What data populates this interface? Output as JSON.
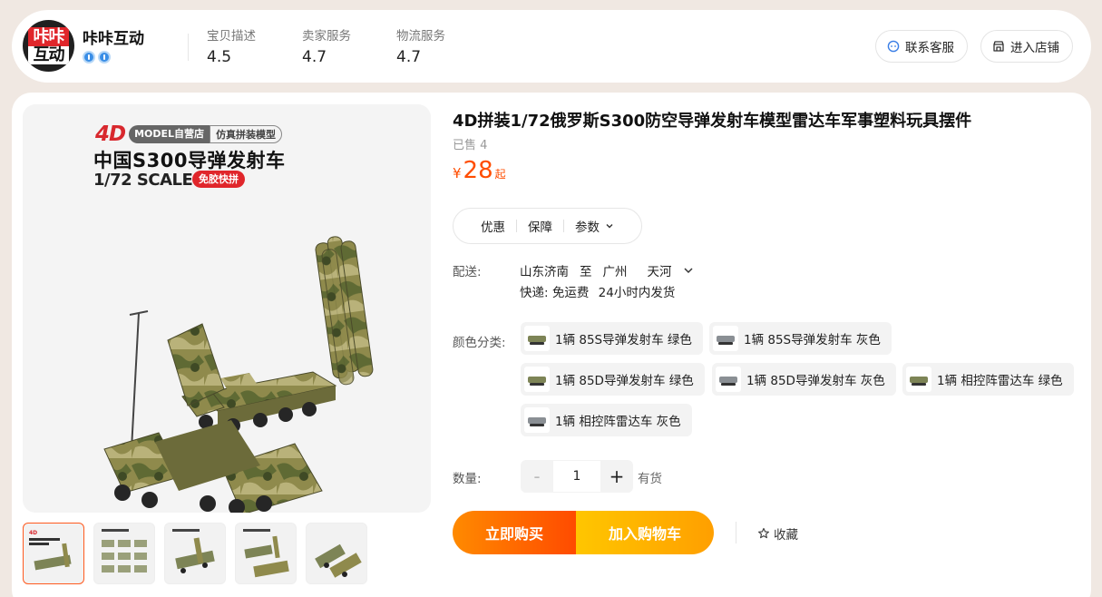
{
  "shop": {
    "name": "咔咔互动",
    "logo_top": "咔咔",
    "logo_bottom": "互动",
    "scores": [
      {
        "label": "宝贝描述",
        "value": "4.5"
      },
      {
        "label": "卖家服务",
        "value": "4.7"
      },
      {
        "label": "物流服务",
        "value": "4.7"
      }
    ],
    "contact_label": "联系客服",
    "enter_label": "进入店铺"
  },
  "gallery": {
    "brand_4d": "4D",
    "brand_tag1": "MODEL自营店",
    "brand_tag2": "仿真拼装模型",
    "promo_title": "中国S300导弹发射车",
    "promo_scale": "1/72 SCALE",
    "promo_badge": "免胶快拼",
    "thumb_count": 5
  },
  "product": {
    "title": "4D拼装1/72俄罗斯S300防空导弹发射车模型雷达车军事塑料玩具摆件",
    "sold": "已售 4",
    "price_currency": "¥",
    "price": "28",
    "price_suffix": "起",
    "info_tabs": [
      "优惠",
      "保障",
      "参数"
    ]
  },
  "shipping": {
    "label": "配送:",
    "from": "山东济南",
    "to_word": "至",
    "to_city": "广州",
    "to_district": "天河",
    "method": "快递: 免运费",
    "dispatch": "24小时内发货"
  },
  "sku": {
    "label": "颜色分类:",
    "options": [
      {
        "label": "1辆 85S导弹发射车 绿色",
        "tone": "green"
      },
      {
        "label": "1辆 85S导弹发射车 灰色",
        "tone": "gray"
      },
      {
        "label": "1辆 85D导弹发射车 绿色",
        "tone": "green"
      },
      {
        "label": "1辆 85D导弹发射车 灰色",
        "tone": "gray"
      },
      {
        "label": "1辆 相控阵雷达车 绿色",
        "tone": "green"
      },
      {
        "label": "1辆 相控阵雷达车 灰色",
        "tone": "gray"
      }
    ]
  },
  "quantity": {
    "label": "数量:",
    "minus": "-",
    "value": "1",
    "plus": "+",
    "stock": "有货"
  },
  "actions": {
    "buy_label": "立即购买",
    "cart_label": "加入购物车",
    "favorite_label": "收藏"
  },
  "colors": {
    "price": "#ff4d00",
    "buy_gradient": "#ff8a00→#ff4b00",
    "cart_gradient": "#ffc600→#ff9f00"
  }
}
